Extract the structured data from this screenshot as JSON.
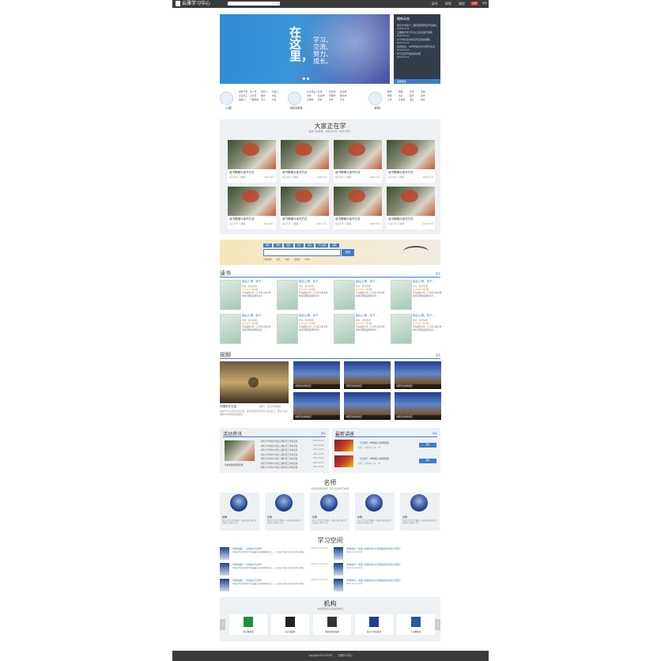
{
  "header": {
    "logo_text": "云雅学习中心",
    "search_placeholder": "",
    "links": [
      "读书",
      "视频",
      "课程"
    ],
    "register": "注册",
    "login": "登录"
  },
  "banner": {
    "big_text": "在这里，",
    "lines": [
      "学习、",
      "交流、",
      "努力、",
      "成长。"
    ]
  },
  "news": {
    "title": "最新动态",
    "items": [
      {
        "t": "南京大学第十二期高级研修班开班典礼",
        "d": "2014-01-12"
      },
      {
        "t": "云雅数字学习平台上线试运行通知",
        "d": "2014-01-12"
      },
      {
        "t": "关于举办读书月系列活动的通知",
        "d": "2014-01-12"
      },
      {
        "t": "名师讲坛：中华传统文化与现代生活",
        "d": "2014-01-12"
      },
      {
        "t": "学习空间开放使用说明",
        "d": "2014-01-12"
      }
    ],
    "more": "查看更多"
  },
  "categories": [
    {
      "label": "人群",
      "items": [
        "领导干部",
        "青少年",
        "老年人",
        "农民工",
        "企业员工",
        "公务员",
        "教师",
        "学生",
        "残疾人",
        "少数民族",
        "军人",
        "妇女"
      ]
    },
    {
      "label": "知识体系",
      "items": [
        "马克思主义",
        "哲学",
        "经济学",
        "政治学",
        "法学",
        "社会学",
        "管理学",
        "教育学",
        "心理学",
        "历史",
        "文学",
        "艺术"
      ]
    },
    {
      "label": "学科",
      "items": [
        "数学",
        "物理",
        "化学",
        "生物",
        "地理",
        "天文",
        "医学",
        "农学",
        "工学",
        "计算机",
        "语言",
        "综合"
      ]
    }
  ],
  "learning": {
    "title": "大家正在学",
    "subtitle": "最热门的课程，快来和大家一起学习吧！",
    "courses": [
      {
        "t": "读书策略与读书方法",
        "m": "南京大学 / 王教授",
        "r": "1342人学习"
      },
      {
        "t": "读书策略与读书方法",
        "m": "南京大学 / 王教授",
        "r": "1342人学习"
      },
      {
        "t": "读书策略与读书方法",
        "m": "南京大学 / 王教授",
        "r": "1342人学习"
      },
      {
        "t": "读书策略与读书方法",
        "m": "南京大学 / 王教授",
        "r": "1342人学习"
      },
      {
        "t": "读书策略与读书方法",
        "m": "南京大学 / 王教授",
        "r": "1342人学习"
      },
      {
        "t": "读书策略与读书方法",
        "m": "南京大学 / 王教授",
        "r": "1342人学习"
      },
      {
        "t": "读书策略与读书方法",
        "m": "南京大学 / 王教授",
        "r": "1342人学习"
      },
      {
        "t": "读书策略与读书方法",
        "m": "南京大学 / 王教授",
        "r": "1342人学习"
      }
    ]
  },
  "search_banner": {
    "tabs": [
      "图书",
      "期刊",
      "报纸",
      "论文",
      "视频",
      "学习资源",
      "课程"
    ],
    "button": "搜索",
    "radios": [
      "全部资源",
      "书名",
      "作者",
      "出版社",
      "ISBN"
    ]
  },
  "books": {
    "title": "读书",
    "more": "更多",
    "items": [
      {
        "t": "脑后心理，孩子…",
        "a": "作者：黄志国/著",
        "s": "★★★★☆",
        "score": "8.0分",
        "d": "不完美的父母，正让孩子失去内在的自我和发展的动力……"
      },
      {
        "t": "脑后心理，孩子…",
        "a": "作者：黄志国/著",
        "s": "★★★★☆",
        "score": "8.0分",
        "d": "不完美的父母，正让孩子失去内在的自我和发展的动力……"
      },
      {
        "t": "脑后心理，孩子…",
        "a": "作者：黄志国/著",
        "s": "★★★★☆",
        "score": "8.0分",
        "d": "不完美的父母，正让孩子失去内在的自我和发展的动力……"
      },
      {
        "t": "脑后心理，孩子…",
        "a": "作者：黄志国/著",
        "s": "★★★★☆",
        "score": "8.0分",
        "d": "不完美的父母，正让孩子失去内在的自我和发展的动力……"
      },
      {
        "t": "脑后心理，孩子…",
        "a": "作者：黄志国/著",
        "s": "★★★★☆",
        "score": "8.0分",
        "d": "不完美的父母，正让孩子失去内在的自我和发展的动力……"
      },
      {
        "t": "脑后心理，孩子…",
        "a": "作者：黄志国/著",
        "s": "★★★★☆",
        "score": "8.0分",
        "d": "不完美的父母，正让孩子失去内在的自我和发展的动力……"
      },
      {
        "t": "脑后心理，孩子…",
        "a": "作者：黄志国/著",
        "s": "★★★★☆",
        "score": "8.0分",
        "d": "不完美的父母，正让孩子失去内在的自我和发展的动力……"
      },
      {
        "t": "脑后心理，孩子…",
        "a": "作者：黄志国/著",
        "s": "★★★★☆",
        "score": "8.0分",
        "d": "不完美的父母，正让孩子失去内在的自我和发展的动力……"
      }
    ]
  },
  "videos": {
    "title": "视频",
    "more": "更多",
    "featured_caption": "中国历史文选",
    "featured_meta": "主讲人：南京大学教授",
    "featured_desc": "本系列节目从历史文选出发，讲述中国历代的文化与思想变迁，帮助学习者理解中华文明的发展脉络。",
    "items": [
      "中国历史建筑欣赏",
      "中国历史建筑欣赏",
      "中国历史建筑欣赏",
      "中国历史建筑欣赏",
      "中国历史建筑欣赏",
      "中国历史建筑欣赏"
    ]
  },
  "activities": {
    "title": "活动资讯",
    "more": "更多",
    "img_caption": "读书交流会即将开幕",
    "items": [
      {
        "t": "· 社区大学举办全市第二期社区工作者培训",
        "d": "2014-12-09"
      },
      {
        "t": "· 社区大学举办全市第二期社区工作者培训",
        "d": "2014-12-09"
      },
      {
        "t": "· 社区大学举办全市第二期社区工作者培训",
        "d": "2014-12-09"
      },
      {
        "t": "· 社区大学举办全市第二期社区工作者培训",
        "d": "2014-12-09"
      },
      {
        "t": "· 社区大学举办全市第二期社区工作者培训",
        "d": "2014-12-09"
      },
      {
        "t": "· 社区大学举办全市第二期社区工作者培训",
        "d": "2014-12-09"
      },
      {
        "t": "· 社区大学举办全市第二期社区工作者培训",
        "d": "2014-12-09"
      }
    ]
  },
  "lectures": {
    "title": "最新讲座",
    "more": "更多",
    "items": [
      {
        "t": "《红楼梦》",
        "t2": "中华名人系列访谈",
        "tm": "时间：12月30日 14：00",
        "btn": "报名"
      },
      {
        "t": "《红楼梦》",
        "t2": "中华名人系列访谈",
        "tm": "时间：12月30日 14：00",
        "btn": "报名"
      }
    ]
  },
  "teachers": {
    "title": "名师",
    "subtitle": "名校名师的讲座，助力您的学习成长",
    "items": [
      {
        "n": "张明",
        "d": "南京大学历史学教授，长期从事中国古代史研究与教学工作。"
      },
      {
        "n": "张明",
        "d": "南京大学历史学教授，长期从事中国古代史研究与教学工作。"
      },
      {
        "n": "张明",
        "d": "南京大学历史学教授，长期从事中国古代史研究与教学工作。"
      },
      {
        "n": "张明",
        "d": "南京大学历史学教授，长期从事中国古代史研究与教学工作。"
      },
      {
        "n": "张明",
        "d": "南京大学历史学教授，长期从事中国古代史研究与教学工作。"
      }
    ]
  },
  "space": {
    "title": "学习空间",
    "left": [
      {
        "t": "张明收藏了《中国古代文学》",
        "dt": "2014-12-11 14:03",
        "d": "中国古代文学是中华民族最宝贵的精神财富之一，它记录了我们先民的生活与情感。"
      },
      {
        "t": "张明收藏了《中国古代文学》",
        "dt": "2014-12-11 14:03",
        "d": "中国古代文学是中华民族最宝贵的精神财富之一，它记录了我们先民的生活与情感。"
      },
      {
        "t": "张明收藏了《中国古代文学》",
        "dt": "2014-12-11 14:03",
        "d": "中国古代文学是中华民族最宝贵的精神财富之一，它记录了我们先民的生活与情感。"
      }
    ],
    "right": [
      {
        "t": "张明收听了讲座 “我国中外交流发展史的历史与现状”",
        "dt": "2014-12-11 14:03"
      },
      {
        "t": "张明收听了讲座 “我国中外交流发展史的历史与现状”",
        "dt": "2014-12-11 14:03"
      },
      {
        "t": "张明收听了讲座 “我国中外交流发展史的历史与现状”",
        "dt": "2014-12-11 14:03"
      }
    ]
  },
  "orgs": {
    "title": "机构",
    "subtitle": "合作机构和资源提供单位",
    "items": [
      "南京图书馆",
      "北京出版社",
      "华夏文化出版社",
      "南京大学出版社",
      "上海图书馆"
    ]
  },
  "footer": {
    "copyright": "Copyright 2010-2015",
    "name": "云雅学习中心"
  }
}
